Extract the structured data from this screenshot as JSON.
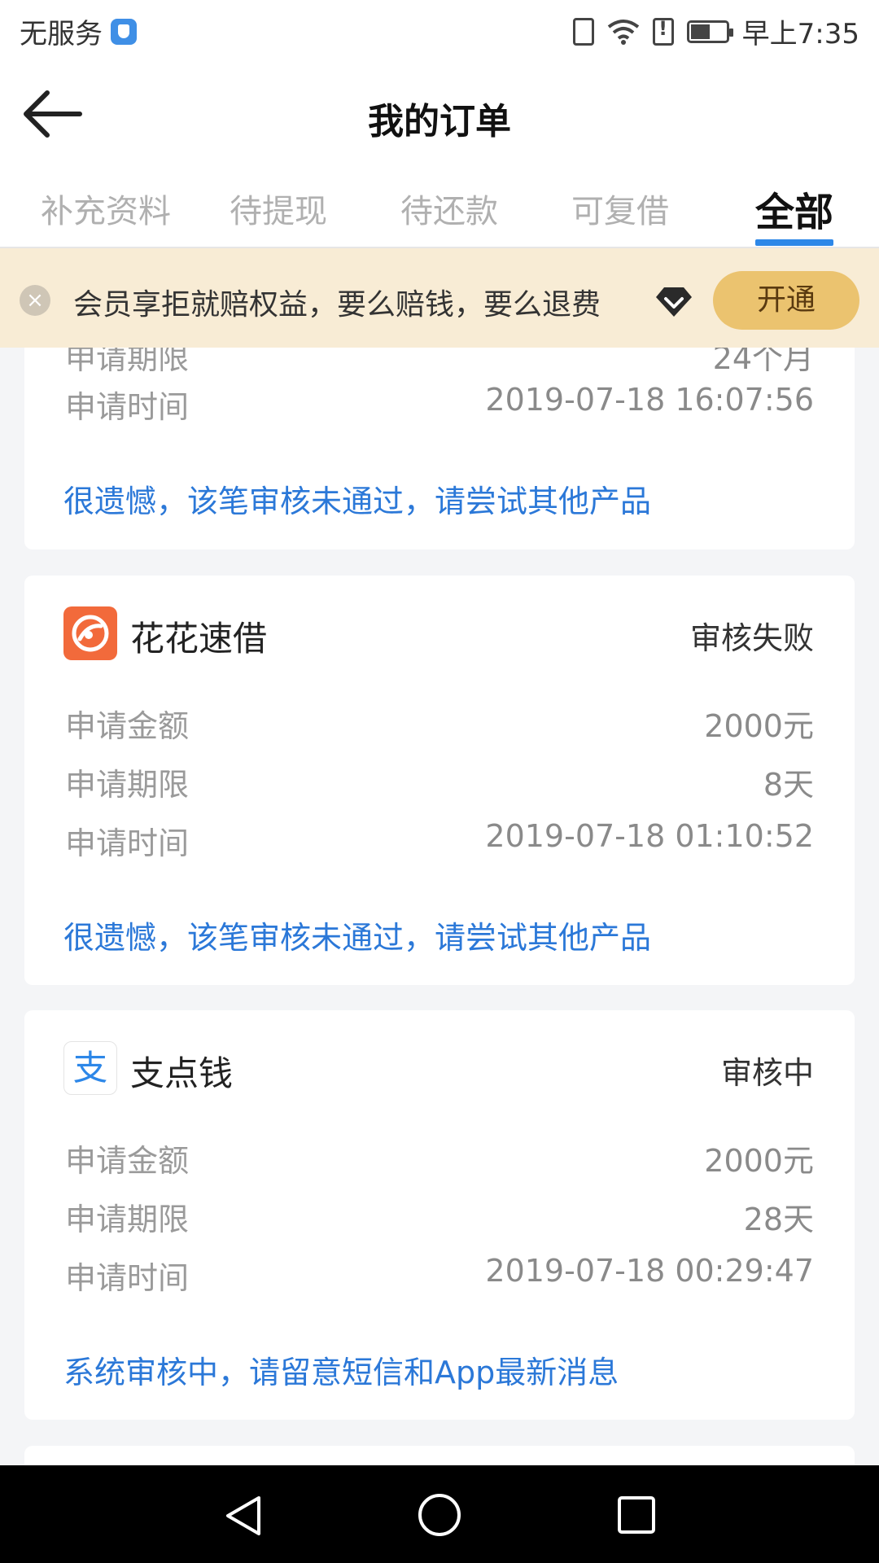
{
  "status_bar": {
    "carrier": "无服务",
    "time": "早上7:35",
    "battery_level": 0.55
  },
  "header": {
    "title": "我的订单",
    "back_icon": "arrow-left-icon"
  },
  "tabs": [
    {
      "label": "补充资料",
      "active": false
    },
    {
      "label": "待提现",
      "active": false
    },
    {
      "label": "待还款",
      "active": false
    },
    {
      "label": "可复借",
      "active": false
    },
    {
      "label": "全部",
      "active": true
    }
  ],
  "banner": {
    "text": "会员享拒就赔权益，要么赔钱，要么退费",
    "close_icon": "×",
    "button": "开通"
  },
  "orders": [
    {
      "partial": true,
      "rows": [
        {
          "label": "申请期限",
          "value": "24个月"
        },
        {
          "label": "申请时间",
          "value": "2019-07-18 16:07:56"
        }
      ],
      "message": "很遗憾，该笔审核未通过，请尝试其他产品"
    },
    {
      "name": "花花速借",
      "status": "审核失败",
      "rows": [
        {
          "label": "申请金额",
          "value": "2000元"
        },
        {
          "label": "申请期限",
          "value": "8天"
        },
        {
          "label": "申请时间",
          "value": "2019-07-18 01:10:52"
        }
      ],
      "message": "很遗憾，该笔审核未通过，请尝试其他产品"
    },
    {
      "name": "支点钱",
      "logo_glyph": "支",
      "status": "审核中",
      "rows": [
        {
          "label": "申请金额",
          "value": "2000元"
        },
        {
          "label": "申请期限",
          "value": "28天"
        },
        {
          "label": "申请时间",
          "value": "2019-07-18 00:29:47"
        }
      ],
      "message": "系统审核中，请留意短信和App最新消息"
    }
  ],
  "colors": {
    "accent_blue": "#2b78d8",
    "tab_underline": "#2d87e8",
    "banner_bg": "#f8ecd5",
    "button_gold": "#ebc36f",
    "huahua_logo": "#f26a3b"
  }
}
